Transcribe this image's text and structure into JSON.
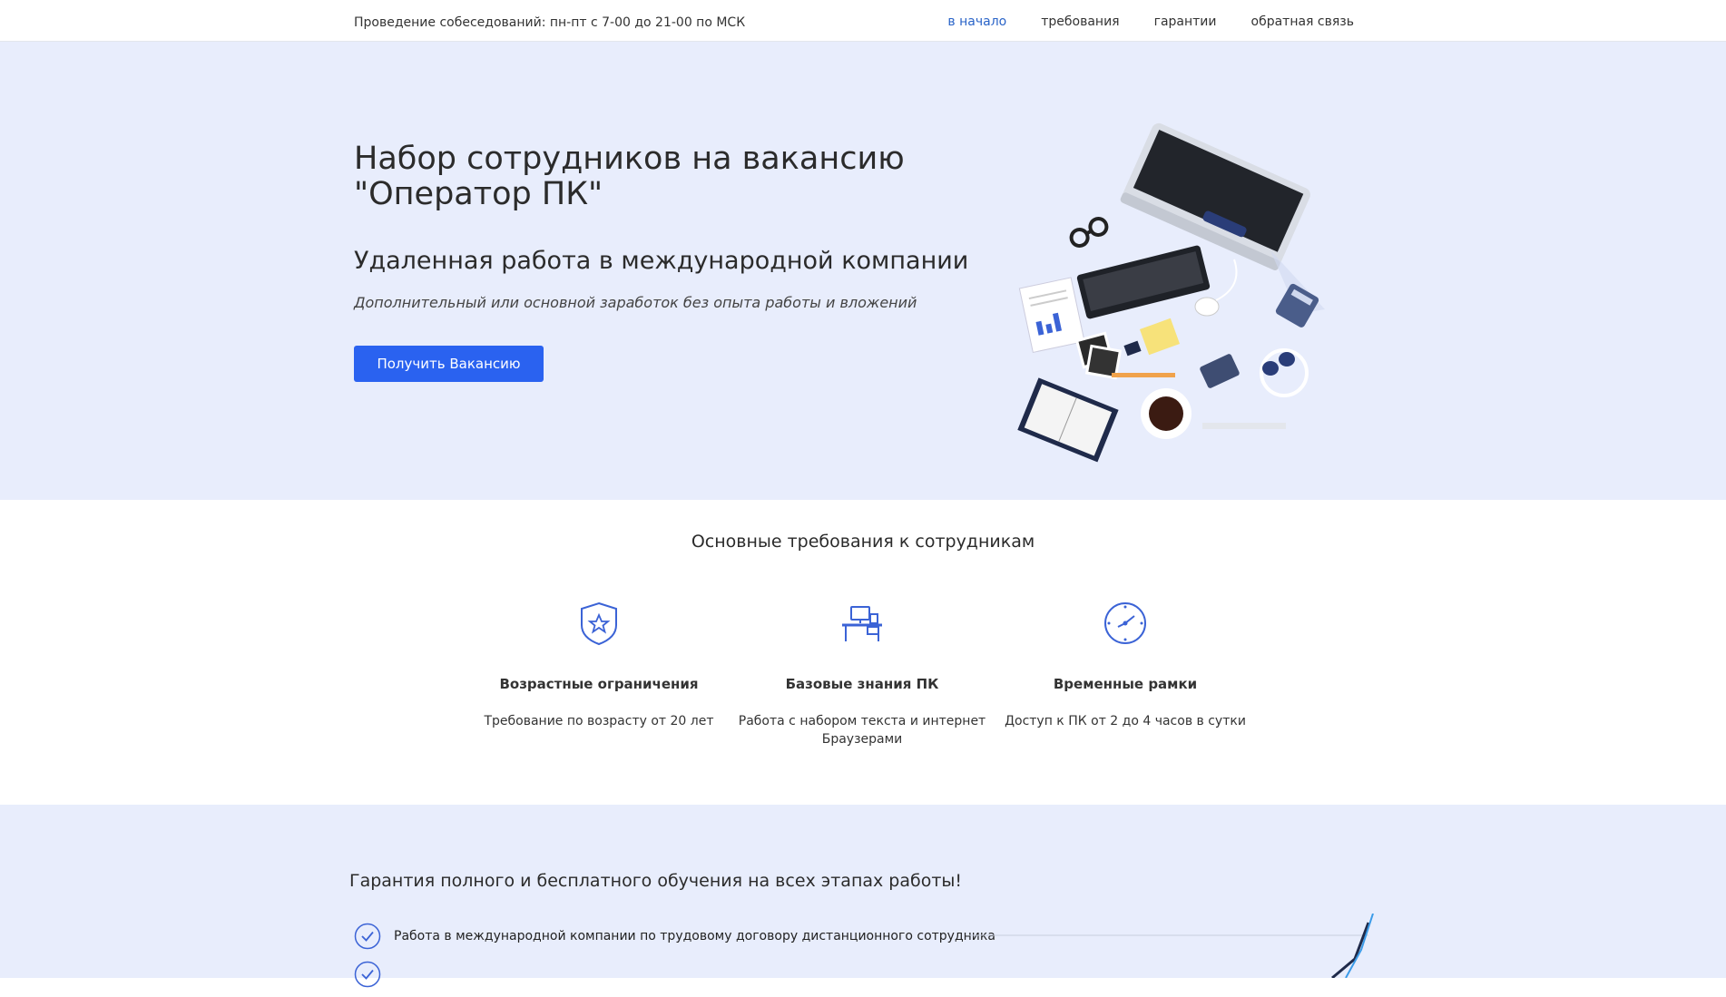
{
  "topbar": {
    "schedule": "Проведение собеседований: пн-пт с 7-00 до 21-00 по МСК",
    "nav": [
      {
        "label": "в начало",
        "active": true
      },
      {
        "label": "требования",
        "active": false
      },
      {
        "label": "гарантии",
        "active": false
      },
      {
        "label": "обратная связь",
        "active": false
      }
    ]
  },
  "hero": {
    "title": "Набор сотрудников на вакансию \"Оператор ПК\"",
    "subtitle": "Удаленная работа в международной компании",
    "tagline": "Дополнительный или основной заработок без опыта работы и вложений",
    "cta_label": "Получить Вакансию"
  },
  "requirements": {
    "heading": "Основные требования к сотрудникам",
    "items": [
      {
        "icon": "shield-star-icon",
        "title": "Возрастные ограничения",
        "text": "Требование по возрасту от 20 лет"
      },
      {
        "icon": "desk-computer-icon",
        "title": "Базовые знания ПК",
        "text": "Работа с набором текста и интернет Браузерами"
      },
      {
        "icon": "clock-icon",
        "title": "Временные рамки",
        "text": "Доступ к ПК от 2 до 4 часов в сутки"
      }
    ]
  },
  "guarantees": {
    "heading": "Гарантия полного и бесплатного обучения на всех этапах работы!",
    "items": [
      "Работа в международной компании по трудовому договору дистанционного сотрудника"
    ]
  },
  "colors": {
    "accent": "#2a62f0",
    "hero_bg": "#e8edfc",
    "icon": "#3b63d6"
  }
}
